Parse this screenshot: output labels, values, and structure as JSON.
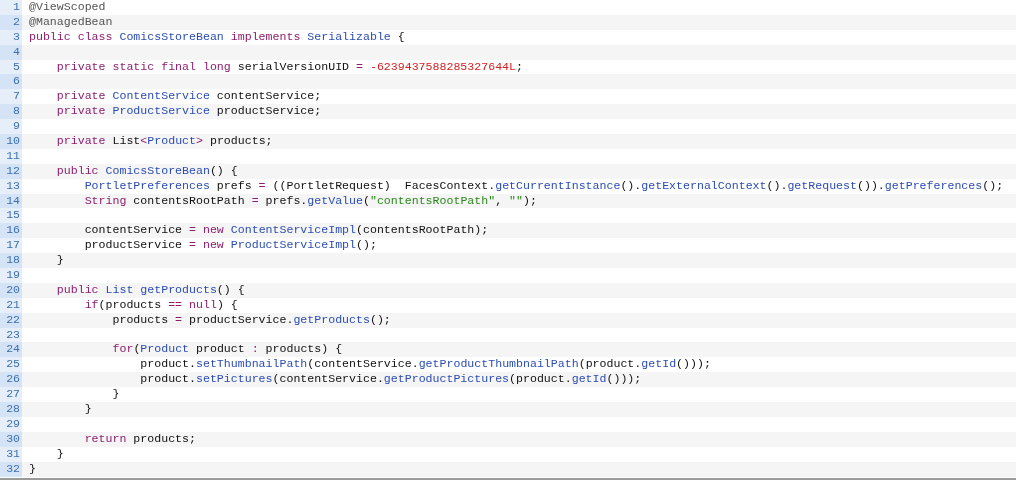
{
  "editor": {
    "lines": [
      {
        "number": "1",
        "tokens": [
          {
            "kind": "annotation",
            "text": "@ViewScoped"
          }
        ]
      },
      {
        "number": "2",
        "tokens": [
          {
            "kind": "annotation",
            "text": "@ManagedBean"
          }
        ]
      },
      {
        "number": "3",
        "tokens": [
          {
            "kind": "keyword",
            "text": "public class "
          },
          {
            "kind": "type",
            "text": "ComicsStoreBean "
          },
          {
            "kind": "keyword",
            "text": "implements "
          },
          {
            "kind": "type",
            "text": "Serializable"
          },
          {
            "kind": "plain",
            "text": " {"
          }
        ]
      },
      {
        "number": "4"
      },
      {
        "number": "5",
        "tokens": [
          {
            "kind": "keyword",
            "text": "    private static final long"
          },
          {
            "kind": "plain",
            "text": " serialVersionUID "
          },
          {
            "kind": "operator",
            "text": "= "
          },
          {
            "kind": "number",
            "text": "-6239437588285327644L"
          },
          {
            "kind": "plain",
            "text": ";"
          }
        ]
      },
      {
        "number": "6"
      },
      {
        "number": "7",
        "tokens": [
          {
            "kind": "keyword",
            "text": "    private "
          },
          {
            "kind": "type",
            "text": "ContentService"
          },
          {
            "kind": "plain",
            "text": " contentService;"
          }
        ]
      },
      {
        "number": "8",
        "tokens": [
          {
            "kind": "keyword",
            "text": "    private "
          },
          {
            "kind": "type",
            "text": "ProductService"
          },
          {
            "kind": "plain",
            "text": " productService;"
          }
        ]
      },
      {
        "number": "9"
      },
      {
        "number": "10",
        "tokens": [
          {
            "kind": "keyword",
            "text": "    private"
          },
          {
            "kind": "plain",
            "text": " List"
          },
          {
            "kind": "operator",
            "text": "<"
          },
          {
            "kind": "type",
            "text": "Product"
          },
          {
            "kind": "operator",
            "text": ">"
          },
          {
            "kind": "plain",
            "text": " products;"
          }
        ]
      },
      {
        "number": "11"
      },
      {
        "number": "12",
        "tokens": [
          {
            "kind": "keyword",
            "text": "    public "
          },
          {
            "kind": "type",
            "text": "ComicsStoreBean"
          },
          {
            "kind": "plain",
            "text": "() {"
          }
        ]
      },
      {
        "number": "13",
        "tokens": [
          {
            "kind": "type",
            "text": "        PortletPreferences"
          },
          {
            "kind": "plain",
            "text": " prefs "
          },
          {
            "kind": "operator",
            "text": "="
          },
          {
            "kind": "plain",
            "text": " ((PortletRequest)  FacesContext."
          },
          {
            "kind": "method",
            "text": "getCurrentInstance"
          },
          {
            "kind": "plain",
            "text": "()."
          },
          {
            "kind": "method",
            "text": "getExternalContext"
          },
          {
            "kind": "plain",
            "text": "()."
          },
          {
            "kind": "method",
            "text": "getRequest"
          },
          {
            "kind": "plain",
            "text": "())."
          },
          {
            "kind": "method",
            "text": "getPreferences"
          },
          {
            "kind": "plain",
            "text": "();"
          }
        ]
      },
      {
        "number": "14",
        "tokens": [
          {
            "kind": "keyword",
            "text": "        String"
          },
          {
            "kind": "plain",
            "text": " contentsRootPath "
          },
          {
            "kind": "operator",
            "text": "="
          },
          {
            "kind": "plain",
            "text": " prefs."
          },
          {
            "kind": "method",
            "text": "getValue"
          },
          {
            "kind": "plain",
            "text": "("
          },
          {
            "kind": "string",
            "text": "\"contentsRootPath\""
          },
          {
            "kind": "plain",
            "text": ", "
          },
          {
            "kind": "string",
            "text": "\"\""
          },
          {
            "kind": "plain",
            "text": ");"
          }
        ]
      },
      {
        "number": "15"
      },
      {
        "number": "16",
        "tokens": [
          {
            "kind": "plain",
            "text": "        contentService "
          },
          {
            "kind": "operator",
            "text": "= "
          },
          {
            "kind": "keyword",
            "text": "new "
          },
          {
            "kind": "type",
            "text": "ContentServiceImpl"
          },
          {
            "kind": "plain",
            "text": "(contentsRootPath);"
          }
        ]
      },
      {
        "number": "17",
        "tokens": [
          {
            "kind": "plain",
            "text": "        productService "
          },
          {
            "kind": "operator",
            "text": "= "
          },
          {
            "kind": "keyword",
            "text": "new "
          },
          {
            "kind": "type",
            "text": "ProductServiceImpl"
          },
          {
            "kind": "plain",
            "text": "();"
          }
        ]
      },
      {
        "number": "18",
        "tokens": [
          {
            "kind": "plain",
            "text": "    }"
          }
        ]
      },
      {
        "number": "19"
      },
      {
        "number": "20",
        "tokens": [
          {
            "kind": "keyword",
            "text": "    public "
          },
          {
            "kind": "type",
            "text": "List "
          },
          {
            "kind": "method",
            "text": "getProducts"
          },
          {
            "kind": "plain",
            "text": "() {"
          }
        ]
      },
      {
        "number": "21",
        "tokens": [
          {
            "kind": "keyword",
            "text": "        if"
          },
          {
            "kind": "plain",
            "text": "(products "
          },
          {
            "kind": "operator",
            "text": "== "
          },
          {
            "kind": "keyword",
            "text": "null"
          },
          {
            "kind": "plain",
            "text": ") {"
          }
        ]
      },
      {
        "number": "22",
        "tokens": [
          {
            "kind": "plain",
            "text": "            products "
          },
          {
            "kind": "operator",
            "text": "="
          },
          {
            "kind": "plain",
            "text": " productService."
          },
          {
            "kind": "method",
            "text": "getProducts"
          },
          {
            "kind": "plain",
            "text": "();"
          }
        ]
      },
      {
        "number": "23"
      },
      {
        "number": "24",
        "tokens": [
          {
            "kind": "keyword",
            "text": "            for"
          },
          {
            "kind": "plain",
            "text": "("
          },
          {
            "kind": "type",
            "text": "Product"
          },
          {
            "kind": "plain",
            "text": " product "
          },
          {
            "kind": "operator",
            "text": ":"
          },
          {
            "kind": "plain",
            "text": " products) {"
          }
        ]
      },
      {
        "number": "25",
        "tokens": [
          {
            "kind": "plain",
            "text": "                product."
          },
          {
            "kind": "method",
            "text": "setThumbnailPath"
          },
          {
            "kind": "plain",
            "text": "(contentService."
          },
          {
            "kind": "method",
            "text": "getProductThumbnailPath"
          },
          {
            "kind": "plain",
            "text": "(product."
          },
          {
            "kind": "method",
            "text": "getId"
          },
          {
            "kind": "plain",
            "text": "()));"
          }
        ]
      },
      {
        "number": "26",
        "tokens": [
          {
            "kind": "plain",
            "text": "                product."
          },
          {
            "kind": "method",
            "text": "setPictures"
          },
          {
            "kind": "plain",
            "text": "(contentService."
          },
          {
            "kind": "method",
            "text": "getProductPictures"
          },
          {
            "kind": "plain",
            "text": "(product."
          },
          {
            "kind": "method",
            "text": "getId"
          },
          {
            "kind": "plain",
            "text": "()));"
          }
        ]
      },
      {
        "number": "27",
        "tokens": [
          {
            "kind": "plain",
            "text": "            }"
          }
        ]
      },
      {
        "number": "28",
        "tokens": [
          {
            "kind": "plain",
            "text": "        }"
          }
        ]
      },
      {
        "number": "29"
      },
      {
        "number": "30",
        "tokens": [
          {
            "kind": "keyword",
            "text": "        return"
          },
          {
            "kind": "plain",
            "text": " products;"
          }
        ]
      },
      {
        "number": "31",
        "tokens": [
          {
            "kind": "plain",
            "text": "    }"
          }
        ]
      },
      {
        "number": "32",
        "tokens": [
          {
            "kind": "plain",
            "text": "}"
          }
        ]
      }
    ]
  }
}
